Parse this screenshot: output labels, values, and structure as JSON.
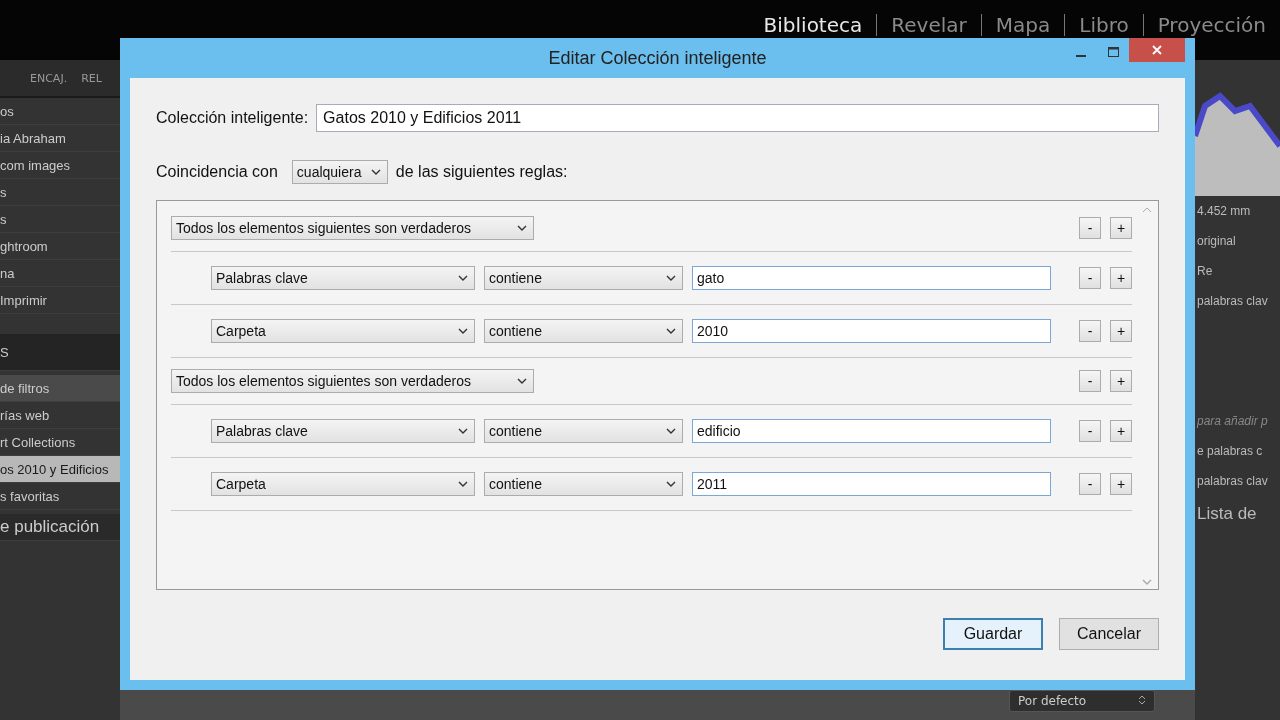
{
  "modules": [
    {
      "label": "Biblioteca",
      "selected": true
    },
    {
      "label": "Revelar",
      "selected": false
    },
    {
      "label": "Mapa",
      "selected": false
    },
    {
      "label": "Libro",
      "selected": false
    },
    {
      "label": "Proyección",
      "selected": false
    }
  ],
  "left_panel": {
    "toolbar": [
      "ENCAJ.",
      "REL"
    ],
    "items": [
      {
        "kind": "item",
        "label": "os",
        "selected": false
      },
      {
        "kind": "item",
        "label": "ia Abraham",
        "selected": false
      },
      {
        "kind": "item",
        "label": "com images",
        "selected": false
      },
      {
        "kind": "item",
        "label": "s",
        "selected": false
      },
      {
        "kind": "item",
        "label": "s",
        "selected": false
      },
      {
        "kind": "item",
        "label": "ghtroom",
        "selected": false
      },
      {
        "kind": "item",
        "label": "na",
        "selected": false
      },
      {
        "kind": "item",
        "label": "Imprimir",
        "selected": false
      },
      {
        "kind": "header",
        "label": "S",
        "selected": false
      },
      {
        "kind": "filter",
        "label": "de filtros",
        "selected": false
      },
      {
        "kind": "item",
        "label": "rías web",
        "selected": false
      },
      {
        "kind": "item",
        "label": "rt Collections",
        "selected": false
      },
      {
        "kind": "item",
        "label": "os 2010 y Edificios",
        "selected": true
      },
      {
        "kind": "item",
        "label": "s favoritas",
        "selected": false
      },
      {
        "kind": "section",
        "label": "e publicación",
        "selected": false
      }
    ]
  },
  "right_panel": {
    "focal_length": "4.452 mm",
    "original": "original",
    "stepper_label": "Re",
    "keywords_1": "palabras clav",
    "hint": "para añadir p",
    "keywords_2": "e palabras c",
    "keywords_3": "palabras clav",
    "section_title": "Lista de"
  },
  "bottom_bar": {
    "sort_select": "Por defecto"
  },
  "dialog": {
    "title": "Editar Colección inteligente",
    "name_label": "Colección inteligente:",
    "name_value": "Gatos 2010 y Edificios 2011",
    "match_prefix": "Coincidencia con",
    "match_value": "cualquiera",
    "match_suffix": "de las siguientes reglas:",
    "rules": [
      {
        "kind": "group",
        "label": "Todos los elementos siguientes son verdaderos",
        "minus": "-",
        "plus": "+",
        "children": [
          {
            "kind": "rule",
            "field": "Palabras clave",
            "operator": "contiene",
            "value": "gato",
            "minus": "-",
            "plus": "+"
          },
          {
            "kind": "rule",
            "field": "Carpeta",
            "operator": "contiene",
            "value": "2010",
            "minus": "-",
            "plus": "+"
          }
        ]
      },
      {
        "kind": "group",
        "label": "Todos los elementos siguientes son verdaderos",
        "minus": "-",
        "plus": "+",
        "children": [
          {
            "kind": "rule",
            "field": "Palabras clave",
            "operator": "contiene",
            "value": "edificio",
            "minus": "-",
            "plus": "+"
          },
          {
            "kind": "rule",
            "field": "Carpeta",
            "operator": "contiene",
            "value": "2011",
            "minus": "-",
            "plus": "+"
          }
        ]
      }
    ],
    "buttons": [
      {
        "label": "Guardar",
        "selected": true
      },
      {
        "label": "Cancelar",
        "selected": false
      }
    ]
  }
}
